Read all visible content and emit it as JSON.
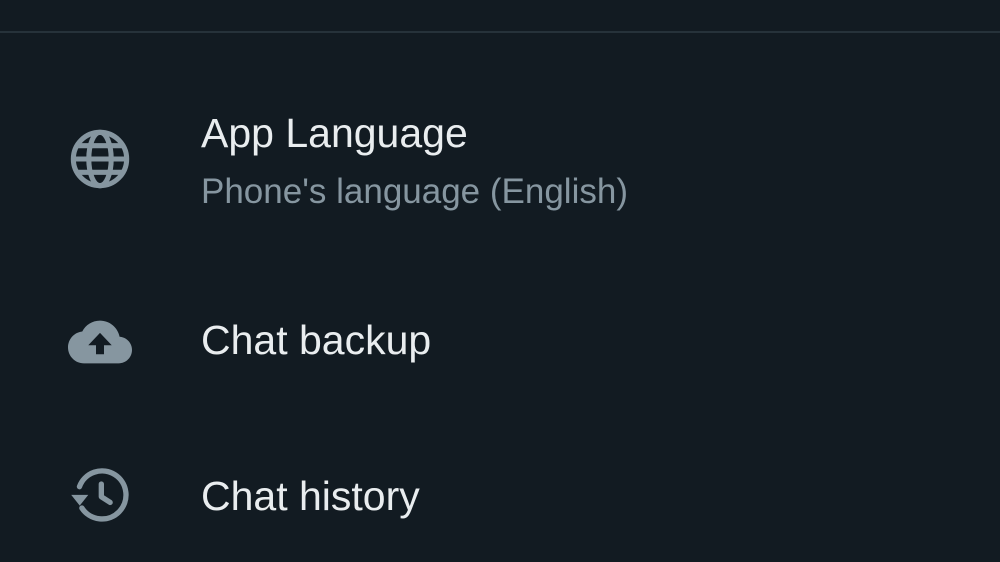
{
  "settings": {
    "items": [
      {
        "title": "App Language",
        "subtitle": "Phone's language (English)",
        "icon": "globe-icon"
      },
      {
        "title": "Chat backup",
        "icon": "cloud-upload-icon"
      },
      {
        "title": "Chat history",
        "icon": "history-icon"
      }
    ]
  },
  "colors": {
    "background": "#121b22",
    "divider": "#26323a",
    "title_text": "#e9edef",
    "subtitle_text": "#8696a0",
    "icon": "#8696a0"
  }
}
